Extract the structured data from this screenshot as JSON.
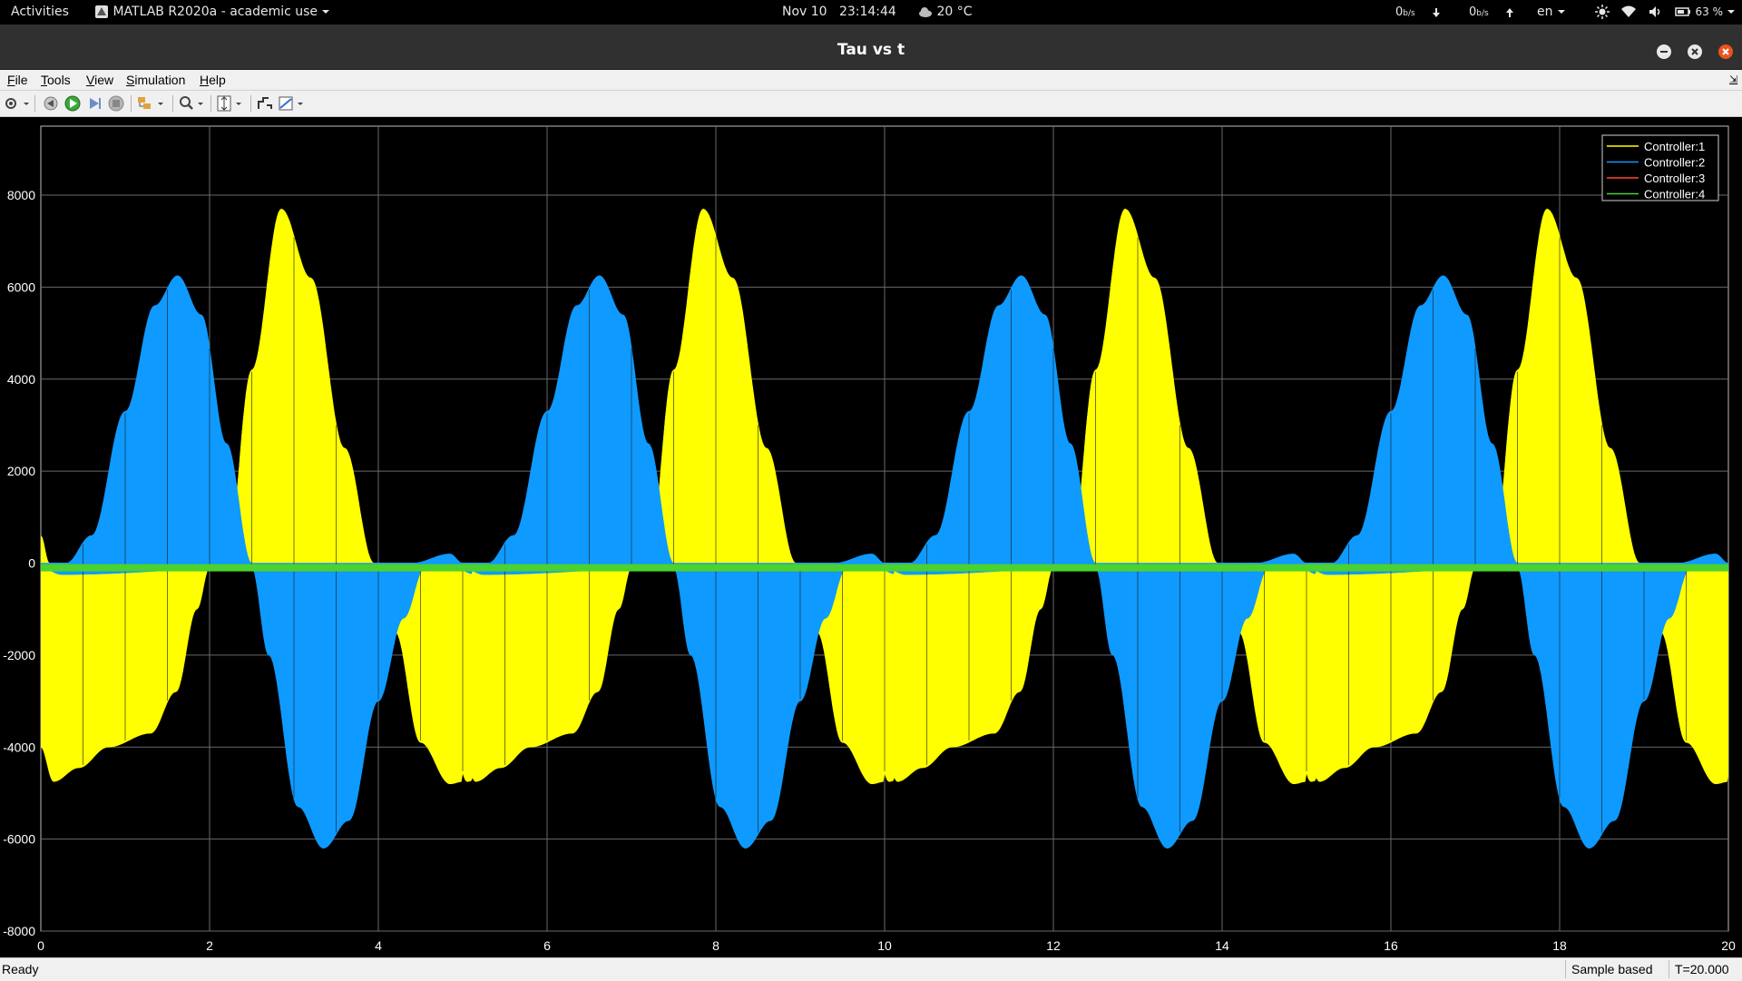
{
  "topbar": {
    "activities": "Activities",
    "app_menu": "MATLAB R2020a - academic use",
    "date": "Nov 10",
    "time": "23:14:44",
    "weather": "20 °C",
    "net_down": "0",
    "net_down_unit": "b/s",
    "net_up": "0",
    "net_up_unit": "b/s",
    "language": "en",
    "battery": "63 %"
  },
  "window": {
    "title": "Tau vs t"
  },
  "menu": {
    "file": "File",
    "tools": "Tools",
    "view": "View",
    "simulation": "Simulation",
    "help": "Help"
  },
  "toolbar_icons": [
    "settings-icon",
    "step-back-icon",
    "run-icon",
    "step-forward-icon",
    "stop-icon",
    "highlight-icon",
    "zoom-icon",
    "autoscale-icon",
    "triggers-icon",
    "cursor-measurements-icon"
  ],
  "status": {
    "ready": "Ready",
    "mode": "Sample based",
    "time": "T=20.000"
  },
  "colors": {
    "controller1": "#ffff00",
    "controller2": "#0f9aff",
    "controller3": "#ff4b2b",
    "controller4": "#4cd22e",
    "grid": "#6a6a6a",
    "axes_bg": "#000000",
    "tick_label": "#ffffff"
  },
  "chart_data": {
    "type": "line",
    "title": "",
    "xlabel": "",
    "ylabel": "",
    "xlim": [
      0,
      20
    ],
    "ylim": [
      -8000,
      9500
    ],
    "xticks": [
      0,
      2,
      4,
      6,
      8,
      10,
      12,
      14,
      16,
      18,
      20
    ],
    "yticks": [
      -8000,
      -6000,
      -4000,
      -2000,
      0,
      2000,
      4000,
      6000,
      8000
    ],
    "grid": true,
    "legend_position": "top-right",
    "period": 5,
    "series": [
      {
        "name": "Controller:1",
        "description": "Yellow envelope; repeats every 5 s",
        "upper_env": [
          [
            0,
            600
          ],
          [
            0.1,
            0
          ],
          [
            2.2,
            0
          ],
          [
            2.5,
            4200
          ],
          [
            2.85,
            7700
          ],
          [
            3.2,
            6200
          ],
          [
            3.6,
            2500
          ],
          [
            3.95,
            0
          ],
          [
            5,
            0
          ]
        ],
        "lower_env": [
          [
            0,
            -4000
          ],
          [
            0.15,
            -4750
          ],
          [
            0.45,
            -4450
          ],
          [
            0.8,
            -4000
          ],
          [
            1.3,
            -3700
          ],
          [
            1.6,
            -2800
          ],
          [
            1.85,
            -1000
          ],
          [
            2.0,
            -100
          ],
          [
            2.2,
            -100
          ],
          [
            2.5,
            -100
          ],
          [
            3.95,
            -100
          ],
          [
            4.2,
            -1500
          ],
          [
            4.5,
            -3900
          ],
          [
            4.85,
            -4800
          ],
          [
            5,
            -4750
          ]
        ]
      },
      {
        "name": "Controller:2",
        "description": "Blue envelope; repeats every 5 s",
        "upper_env": [
          [
            0,
            0
          ],
          [
            0.3,
            0
          ],
          [
            0.6,
            600
          ],
          [
            1.0,
            3300
          ],
          [
            1.35,
            5600
          ],
          [
            1.62,
            6250
          ],
          [
            1.9,
            5400
          ],
          [
            2.2,
            2600
          ],
          [
            2.5,
            0
          ],
          [
            4.4,
            0
          ],
          [
            4.85,
            200
          ],
          [
            5,
            0
          ]
        ],
        "lower_env": [
          [
            0,
            -100
          ],
          [
            0.25,
            -250
          ],
          [
            2.5,
            -100
          ],
          [
            2.7,
            -2000
          ],
          [
            3.05,
            -5300
          ],
          [
            3.35,
            -6200
          ],
          [
            3.65,
            -5600
          ],
          [
            4.0,
            -3000
          ],
          [
            4.3,
            -1200
          ],
          [
            4.55,
            -100
          ],
          [
            5,
            -100
          ]
        ]
      },
      {
        "name": "Controller:3",
        "description": "Near zero, hidden under Controller:4",
        "values": [
          [
            0,
            -50
          ],
          [
            20,
            -50
          ]
        ]
      },
      {
        "name": "Controller:4",
        "description": "Thick green band around zero",
        "values": [
          [
            0,
            -100
          ],
          [
            20,
            -100
          ]
        ]
      }
    ]
  }
}
